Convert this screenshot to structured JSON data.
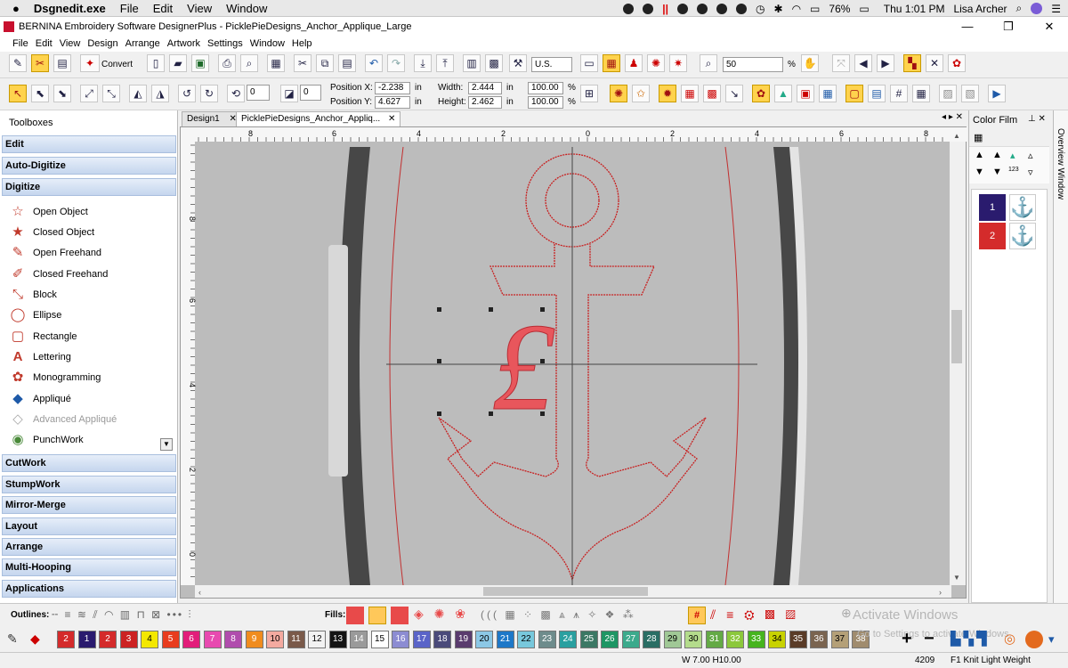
{
  "mac_menu": {
    "app": "Dsgnedit.exe",
    "items": [
      "File",
      "Edit",
      "View",
      "Window"
    ],
    "battery": "76%",
    "clock": "Thu 1:01 PM",
    "user": "Lisa Archer"
  },
  "window": {
    "title": "BERNINA Embroidery Software DesignerPlus - PicklePieDesigns_Anchor_Applique_Large",
    "min": "—",
    "restore": "❐",
    "close": "✕"
  },
  "menu": [
    "File",
    "Edit",
    "View",
    "Design",
    "Arrange",
    "Artwork",
    "Settings",
    "Window",
    "Help"
  ],
  "toolbar1": {
    "convert_label": "Convert",
    "units": "U.S.",
    "zoom": "50",
    "zoom_unit": "%"
  },
  "toolbar2": {
    "rotate_val": "0",
    "slant_val": "0",
    "pos_x_label": "Position X:",
    "pos_x": "-2.238",
    "pos_y_label": "Position Y:",
    "pos_y": "4.627",
    "unit": "in",
    "width_label": "Width:",
    "width": "2.444",
    "height_label": "Height:",
    "height": "2.462",
    "scale_w": "100.00",
    "scale_h": "100.00",
    "pct": "%"
  },
  "left_panel": {
    "title": "Toolboxes",
    "groups_top": [
      "Edit",
      "Auto-Digitize",
      "Digitize"
    ],
    "tools": [
      {
        "label": "Open Object",
        "icon": "star-outline-icon",
        "glyph": "☆"
      },
      {
        "label": "Closed Object",
        "icon": "star-filled-icon",
        "glyph": "★"
      },
      {
        "label": "Open Freehand",
        "icon": "freehand-icon",
        "glyph": "✎"
      },
      {
        "label": "Closed Freehand",
        "icon": "closed-freehand-icon",
        "glyph": "✐"
      },
      {
        "label": "Block",
        "icon": "block-icon",
        "glyph": "⤡"
      },
      {
        "label": "Ellipse",
        "icon": "ellipse-icon",
        "glyph": "◯"
      },
      {
        "label": "Rectangle",
        "icon": "rectangle-icon",
        "glyph": "▢"
      },
      {
        "label": "Lettering",
        "icon": "lettering-icon",
        "glyph": "A"
      },
      {
        "label": "Monogramming",
        "icon": "monogram-icon",
        "glyph": "✿"
      },
      {
        "label": "Appliqué",
        "icon": "applique-icon",
        "glyph": "◆"
      },
      {
        "label": "Advanced Appliqué",
        "icon": "advanced-applique-icon",
        "glyph": "◇"
      },
      {
        "label": "PunchWork",
        "icon": "punchwork-icon",
        "glyph": "◉"
      }
    ],
    "groups_bottom": [
      "CutWork",
      "StumpWork",
      "Mirror-Merge",
      "Layout",
      "Arrange",
      "Multi-Hooping",
      "Applications"
    ]
  },
  "tabs": [
    {
      "label": "Design1"
    },
    {
      "label": "PicklePieDesigns_Anchor_Appliq..."
    }
  ],
  "ruler": {
    "top_ticks": [
      "8",
      "6",
      "4",
      "2",
      "0",
      "2",
      "4",
      "6",
      "8"
    ],
    "left_ticks": [
      "8",
      "6",
      "4",
      "2",
      "0"
    ]
  },
  "design": {
    "monogram_letter": "£"
  },
  "color_film": {
    "title": "Color Film",
    "items": [
      {
        "num": "1",
        "color": "#2a1b6e",
        "thumb": "anchor-blue-icon"
      },
      {
        "num": "2",
        "color": "#d42b2b",
        "thumb": "anchor-red-icon"
      }
    ]
  },
  "overview_label": "Overview Window",
  "bottom": {
    "outlines_label": "Outlines:",
    "fills_label": "Fills:"
  },
  "watermark": {
    "line1": "Activate Windows",
    "line2": "Go to Settings to activate Windows."
  },
  "palette": [
    {
      "n": "2",
      "c": "#d42b2b"
    },
    {
      "n": "1",
      "c": "#2a1b6e"
    },
    {
      "n": "2",
      "c": "#d42b2b"
    },
    {
      "n": "3",
      "c": "#cc2222"
    },
    {
      "n": "4",
      "c": "#f4e800"
    },
    {
      "n": "5",
      "c": "#e83c1e"
    },
    {
      "n": "6",
      "c": "#e21d7a"
    },
    {
      "n": "7",
      "c": "#e84ab0"
    },
    {
      "n": "8",
      "c": "#b04dad"
    },
    {
      "n": "9",
      "c": "#f08c1e"
    },
    {
      "n": "10",
      "c": "#f4aaa0"
    },
    {
      "n": "11",
      "c": "#7a5a4a"
    },
    {
      "n": "12",
      "c": "#f2f2f2"
    },
    {
      "n": "13",
      "c": "#141414"
    },
    {
      "n": "14",
      "c": "#9a9a9a"
    },
    {
      "n": "15",
      "c": "#ffffff"
    },
    {
      "n": "16",
      "c": "#8c8cd2"
    },
    {
      "n": "17",
      "c": "#5a64c8"
    },
    {
      "n": "18",
      "c": "#4b4b7a"
    },
    {
      "n": "19",
      "c": "#5a3c6e"
    },
    {
      "n": "20",
      "c": "#8cc8e6"
    },
    {
      "n": "21",
      "c": "#1e78c8"
    },
    {
      "n": "22",
      "c": "#78c8dc"
    },
    {
      "n": "23",
      "c": "#6e8c8c"
    },
    {
      "n": "24",
      "c": "#2aa0a0"
    },
    {
      "n": "25",
      "c": "#3c7864"
    },
    {
      "n": "26",
      "c": "#1e9664"
    },
    {
      "n": "27",
      "c": "#3caa8c"
    },
    {
      "n": "28",
      "c": "#2a6e64"
    },
    {
      "n": "29",
      "c": "#a0c896"
    },
    {
      "n": "30",
      "c": "#b4dc8c"
    },
    {
      "n": "31",
      "c": "#64aa46"
    },
    {
      "n": "32",
      "c": "#8cc83c"
    },
    {
      "n": "33",
      "c": "#46b41e"
    },
    {
      "n": "34",
      "c": "#c8d200"
    },
    {
      "n": "35",
      "c": "#5a3c28"
    },
    {
      "n": "36",
      "c": "#7a6450"
    },
    {
      "n": "37",
      "c": "#b4a078"
    },
    {
      "n": "38",
      "c": "#a08c6e"
    }
  ],
  "status": {
    "size": "W 7.00 H10.00",
    "stitches": "4209",
    "fabric": "F1 Knit Light Weight"
  }
}
